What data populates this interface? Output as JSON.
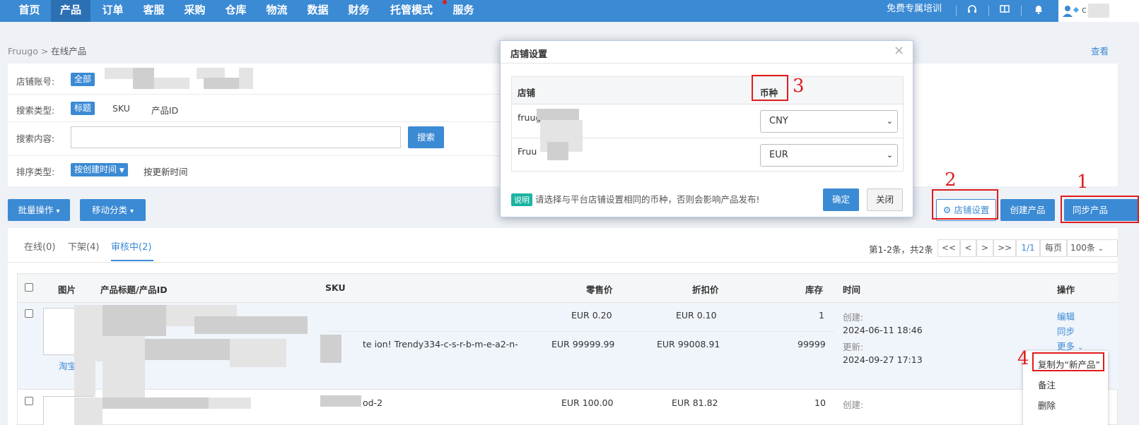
{
  "nav": {
    "items": [
      "首页",
      "产品",
      "订单",
      "客服",
      "采购",
      "仓库",
      "物流",
      "数据",
      "财务",
      "托管模式",
      "服务"
    ],
    "active": "产品",
    "training": "免费专属培训",
    "user_initial": "c"
  },
  "breadcrumb": {
    "root": "Fruugo",
    "sep": " > ",
    "current": "在线产品"
  },
  "view_link": "查看",
  "filter": {
    "shop_label": "店铺账号:",
    "shop_tag": "全部",
    "search_type_label": "搜索类型:",
    "search_types": [
      "标题",
      "SKU",
      "产品ID"
    ],
    "search_content_label": "搜索内容:",
    "search_button": "搜索",
    "sort_label": "排序类型:",
    "sort_active": "按创建时间",
    "sort_other": "按更新时间"
  },
  "actions": {
    "batch": "批量操作",
    "move": "移动分类",
    "shop_settings": "店铺设置",
    "create": "创建产品",
    "sync": "同步产品"
  },
  "annotations": [
    "1",
    "2",
    "3",
    "4"
  ],
  "tabs": [
    {
      "label": "在线(0)"
    },
    {
      "label": "下架(4)"
    },
    {
      "label": "审核中(2)",
      "active": true
    }
  ],
  "pagination": {
    "summary": "第1-2条，共2条",
    "first": "<<",
    "prev": "<",
    "next": ">",
    "last": ">>",
    "page": "1/1",
    "per_page_label": "每页",
    "per_page": "100条"
  },
  "table": {
    "headers": [
      "图片",
      "产品标题/产品ID",
      "SKU",
      "零售价",
      "折扣价",
      "库存",
      "时间",
      "操作"
    ],
    "rows": [
      {
        "img_caption": "淘宝",
        "sku": "te ion! Trendy334-c-s-r-b-m-e-a2-n-",
        "retail_price": "EUR  0.20",
        "retail_price_2": "EUR  99999.99",
        "discount_price": "EUR  0.10",
        "discount_price_2": "EUR  99008.91",
        "stock": "1",
        "stock_2": "99999",
        "created_label": "创建:",
        "created": "2024-06-11 18:46",
        "updated_label": "更新:",
        "updated": "2024-09-27 17:13",
        "op_edit": "编辑",
        "op_sync": "同步",
        "op_more": "更多"
      },
      {
        "sku": "od-2",
        "retail_price": "EUR  100.00",
        "discount_price": "EUR  81.82",
        "stock": "10",
        "created_label": "创建:"
      }
    ]
  },
  "more_menu": [
    "复制为“新产品”",
    "备注",
    "删除"
  ],
  "modal": {
    "title": "店铺设置",
    "close": "×",
    "col_shop": "店铺",
    "col_currency": "币种",
    "rows": [
      {
        "shop": "fruug",
        "currency": "CNY"
      },
      {
        "shop": "Fruu",
        "currency": "EUR"
      }
    ],
    "note_badge": "说明",
    "note": "请选择与平台店铺设置相同的币种，否则会影响产品发布!",
    "ok": "确定",
    "cancel": "关闭"
  },
  "colors": {
    "primary": "#3b8ad4",
    "nav_active": "#2c70b4",
    "annotation": "#e01c1c",
    "note_badge": "#1cb3a2"
  }
}
